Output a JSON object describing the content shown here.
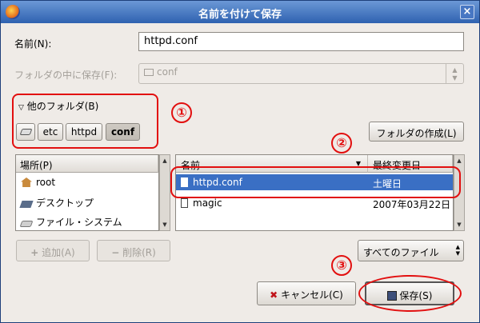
{
  "window": {
    "title": "名前を付けて保存",
    "close_glyph": "×"
  },
  "name_label": "名前(N):",
  "name_value": "httpd.conf",
  "save_in_label": "フォルダの中に保存(F):",
  "save_in_value": "conf",
  "other_folders_label": "他のフォルダ(B)",
  "path_buttons": [
    "etc",
    "httpd",
    "conf"
  ],
  "create_folder_label": "フォルダの作成(L)",
  "places": {
    "header": "場所(P)",
    "items": [
      {
        "label": "root",
        "icon": "home-icon"
      },
      {
        "label": "デスクトップ",
        "icon": "desktop-icon"
      },
      {
        "label": "ファイル・システム",
        "icon": "drive-icon"
      }
    ]
  },
  "add_label": "追加(A)",
  "remove_label": "削除(R)",
  "files": {
    "col_name": "名前",
    "col_modified": "最終変更日",
    "rows": [
      {
        "name": "httpd.conf",
        "modified": "土曜日"
      },
      {
        "name": "magic",
        "modified": "2007年03月22日"
      }
    ]
  },
  "filter_label": "すべてのファイル",
  "cancel_label": "キャンセル(C)",
  "save_label": "保存(S)",
  "annotations": [
    "①",
    "②",
    "③"
  ],
  "colors": {
    "annotation": "#e20f0f",
    "selection": "#3a6fc4",
    "titlebar": "#2f62b0"
  }
}
